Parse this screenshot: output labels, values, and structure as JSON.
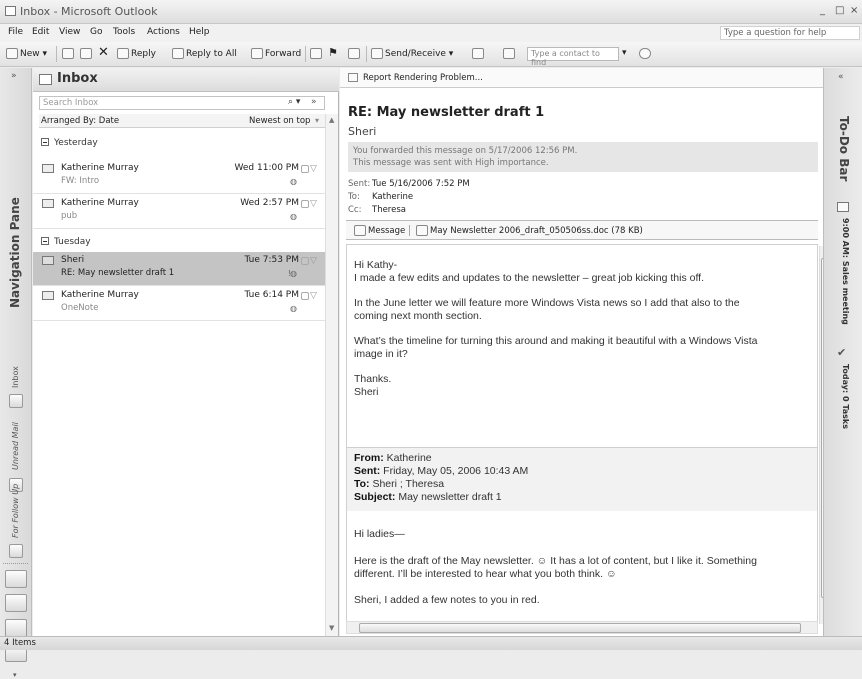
{
  "window": {
    "title": "Inbox - Microsoft Outlook",
    "controls": [
      "_",
      "□",
      "×"
    ]
  },
  "menubar": {
    "items": [
      "File",
      "Edit",
      "View",
      "Go",
      "Tools",
      "Actions",
      "Help"
    ],
    "ask_placeholder": "Type a question for help"
  },
  "toolbar": {
    "new": "New",
    "reply": "Reply",
    "reply_all": "Reply to All",
    "forward": "Forward",
    "send_receive": "Send/Receive",
    "contact_placeholder": "Type a contact to find"
  },
  "nav": {
    "label": "Navigation Pane",
    "collapse": "»",
    "inbox_label": "Inbox",
    "unread_label": "Unread Mail",
    "followup_label": "For Follow Up"
  },
  "list": {
    "folder": "Inbox",
    "search_placeholder": "Search Inbox",
    "arranged_by": "Arranged By: Date",
    "sort": "Newest on top",
    "groups": [
      {
        "label": "Yesterday",
        "items": [
          {
            "from": "Katherine Murray",
            "date": "Wed 11:00 PM",
            "subject": "FW: Intro",
            "selected": false
          },
          {
            "from": "Katherine Murray",
            "date": "Wed 2:57 PM",
            "subject": "pub",
            "selected": false
          }
        ]
      },
      {
        "label": "Tuesday",
        "items": [
          {
            "from": "Sheri",
            "date": "Tue 7:53 PM",
            "subject": "RE: May newsletter draft 1",
            "selected": true
          },
          {
            "from": "Katherine Murray",
            "date": "Tue 6:14 PM",
            "subject": "OneNote",
            "selected": false
          }
        ]
      }
    ]
  },
  "reading": {
    "report_problem": "Report Rendering Problem...",
    "subject": "RE: May newsletter draft 1",
    "sender": "Sheri",
    "info_lines": [
      "You forwarded this message on 5/17/2006 12:56 PM.",
      "This message was sent with High importance."
    ],
    "sent_label": "Sent:",
    "sent_value": "Tue 5/16/2006 7:52 PM",
    "to_label": "To:",
    "to_value": "Katherine",
    "cc_label": "Cc:",
    "cc_value": "Theresa",
    "attach_message": "Message",
    "attach_file": "May Newsletter 2006_draft_050506ss.doc (78 KB)",
    "body": [
      "Hi Kathy-",
      "I made a few edits and updates to the newsletter – great job kicking this off.",
      "In the June letter we will feature more Windows Vista news so I add that also to the",
      "coming next month section.",
      "What’s the timeline for turning this around and making it beautiful with a Windows Vista",
      "image in it?",
      "Thanks.",
      "Sheri"
    ],
    "reply_from_label": "From:",
    "reply_from": "Katherine",
    "reply_sent_label": "Sent:",
    "reply_sent": "Friday, May 05, 2006 10:43 AM",
    "reply_to_label": "To:",
    "reply_to": "Sheri ; Theresa",
    "reply_subject_label": "Subject:",
    "reply_subject": "May newsletter draft 1",
    "body2": [
      "Hi ladies—",
      "Here is the draft of the May newsletter. ☺ It has a lot of content, but I like it. Something",
      "different. I’ll be interested to hear what you both think. ☺",
      "Sheri, I added a few notes to you in red."
    ]
  },
  "todo": {
    "label": "To-Do Bar",
    "appointment": "9:00 AM: Sales meeting",
    "tasks": "Today: 0 Tasks"
  },
  "status": {
    "items": "4 Items"
  }
}
